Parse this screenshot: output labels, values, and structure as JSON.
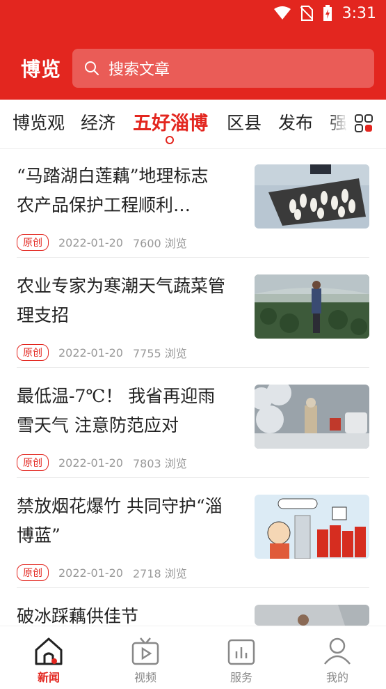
{
  "status": {
    "time": "3:31"
  },
  "header": {
    "brand": "博览",
    "search_placeholder": "搜索文章"
  },
  "tabs": [
    {
      "label": "博览观"
    },
    {
      "label": "经济"
    },
    {
      "label": "五好淄博"
    },
    {
      "label": "区县"
    },
    {
      "label": "发布"
    },
    {
      "label": "强"
    }
  ],
  "articles": [
    {
      "title": "“马踏湖白莲藕”地理标志农产品保护工程顺利…",
      "badge": "原创",
      "date": "2022-01-20",
      "views": "7600 浏览"
    },
    {
      "title": "农业专家为寒潮天气蔬菜管理支招",
      "badge": "原创",
      "date": "2022-01-20",
      "views": "7755 浏览"
    },
    {
      "title": "最低温-7℃！ 我省再迎雨雪天气 注意防范应对",
      "badge": "原创",
      "date": "2022-01-20",
      "views": "7803 浏览"
    },
    {
      "title": "禁放烟花爆竹 共同守护“淄博蓝”",
      "badge": "原创",
      "date": "2022-01-20",
      "views": "2718 浏览"
    },
    {
      "title": "破冰踩藕供佳节"
    }
  ],
  "bottom_nav": [
    {
      "label": "新闻"
    },
    {
      "label": "视频"
    },
    {
      "label": "服务"
    },
    {
      "label": "我的"
    }
  ],
  "colors": {
    "brand_red": "#e3261f"
  }
}
